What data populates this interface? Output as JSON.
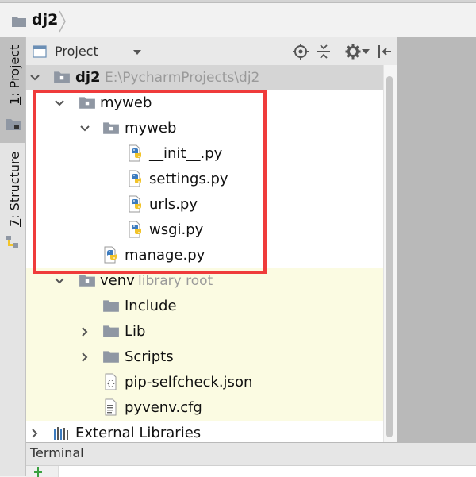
{
  "navbar": {
    "project": "dj2"
  },
  "tool_tabs": {
    "project": {
      "number": "1",
      "label": "Project"
    },
    "structure": {
      "number": "7",
      "label": "Structure"
    }
  },
  "panel": {
    "title": "Project",
    "toolbar_icons": [
      "target-icon",
      "collapse-icon",
      "gear-icon",
      "pin-icon"
    ]
  },
  "tree": {
    "root": {
      "name": "dj2",
      "path": "E:\\PycharmProjects\\dj2"
    },
    "myweb": "myweb",
    "myweb_pkg": "myweb",
    "init": "__init__.py",
    "settings": "settings.py",
    "urls": "urls.py",
    "wsgi": "wsgi.py",
    "manage": "manage.py",
    "venv": {
      "name": "venv",
      "note": "library root"
    },
    "include": "Include",
    "lib": "Lib",
    "scripts": "Scripts",
    "pip": "pip-selfcheck.json",
    "pyvenv": "pyvenv.cfg",
    "external": "External Libraries"
  },
  "terminal": {
    "title": "Terminal"
  },
  "colors": {
    "highlight": "#ef3b3b",
    "library_bg": "#fbfbe2",
    "folder": "#8f97a3"
  }
}
